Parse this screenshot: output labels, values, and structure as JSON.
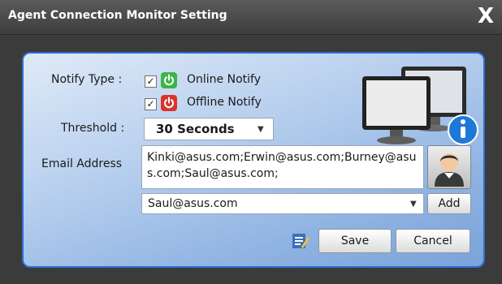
{
  "window": {
    "title": "Agent Connection Monitor Setting",
    "close_glyph": "X"
  },
  "notify": {
    "label": "Notify Type :",
    "online": {
      "label": "Online Notify",
      "checked": true,
      "icon": "power-icon",
      "color": "#3cb44a"
    },
    "offline": {
      "label": "Offline Notify",
      "checked": true,
      "icon": "power-icon",
      "color": "#d9342b"
    }
  },
  "threshold": {
    "label": "Threshold :",
    "value": "30 Seconds"
  },
  "email": {
    "label": "Email Address",
    "value": "Kinki@asus.com;Erwin@asus.com;Burney@asus.com;Saul@asus.com;",
    "selected": "Saul@asus.com",
    "add_label": "Add"
  },
  "buttons": {
    "save": "Save",
    "cancel": "Cancel"
  },
  "icons": {
    "monitors": "monitor-info-icon",
    "contact": "contact-avatar-icon",
    "edit": "edit-note-icon"
  },
  "colors": {
    "accent": "#2d6fd0",
    "panel": "#b7cfee",
    "titlebar": "#4a4a4a"
  }
}
